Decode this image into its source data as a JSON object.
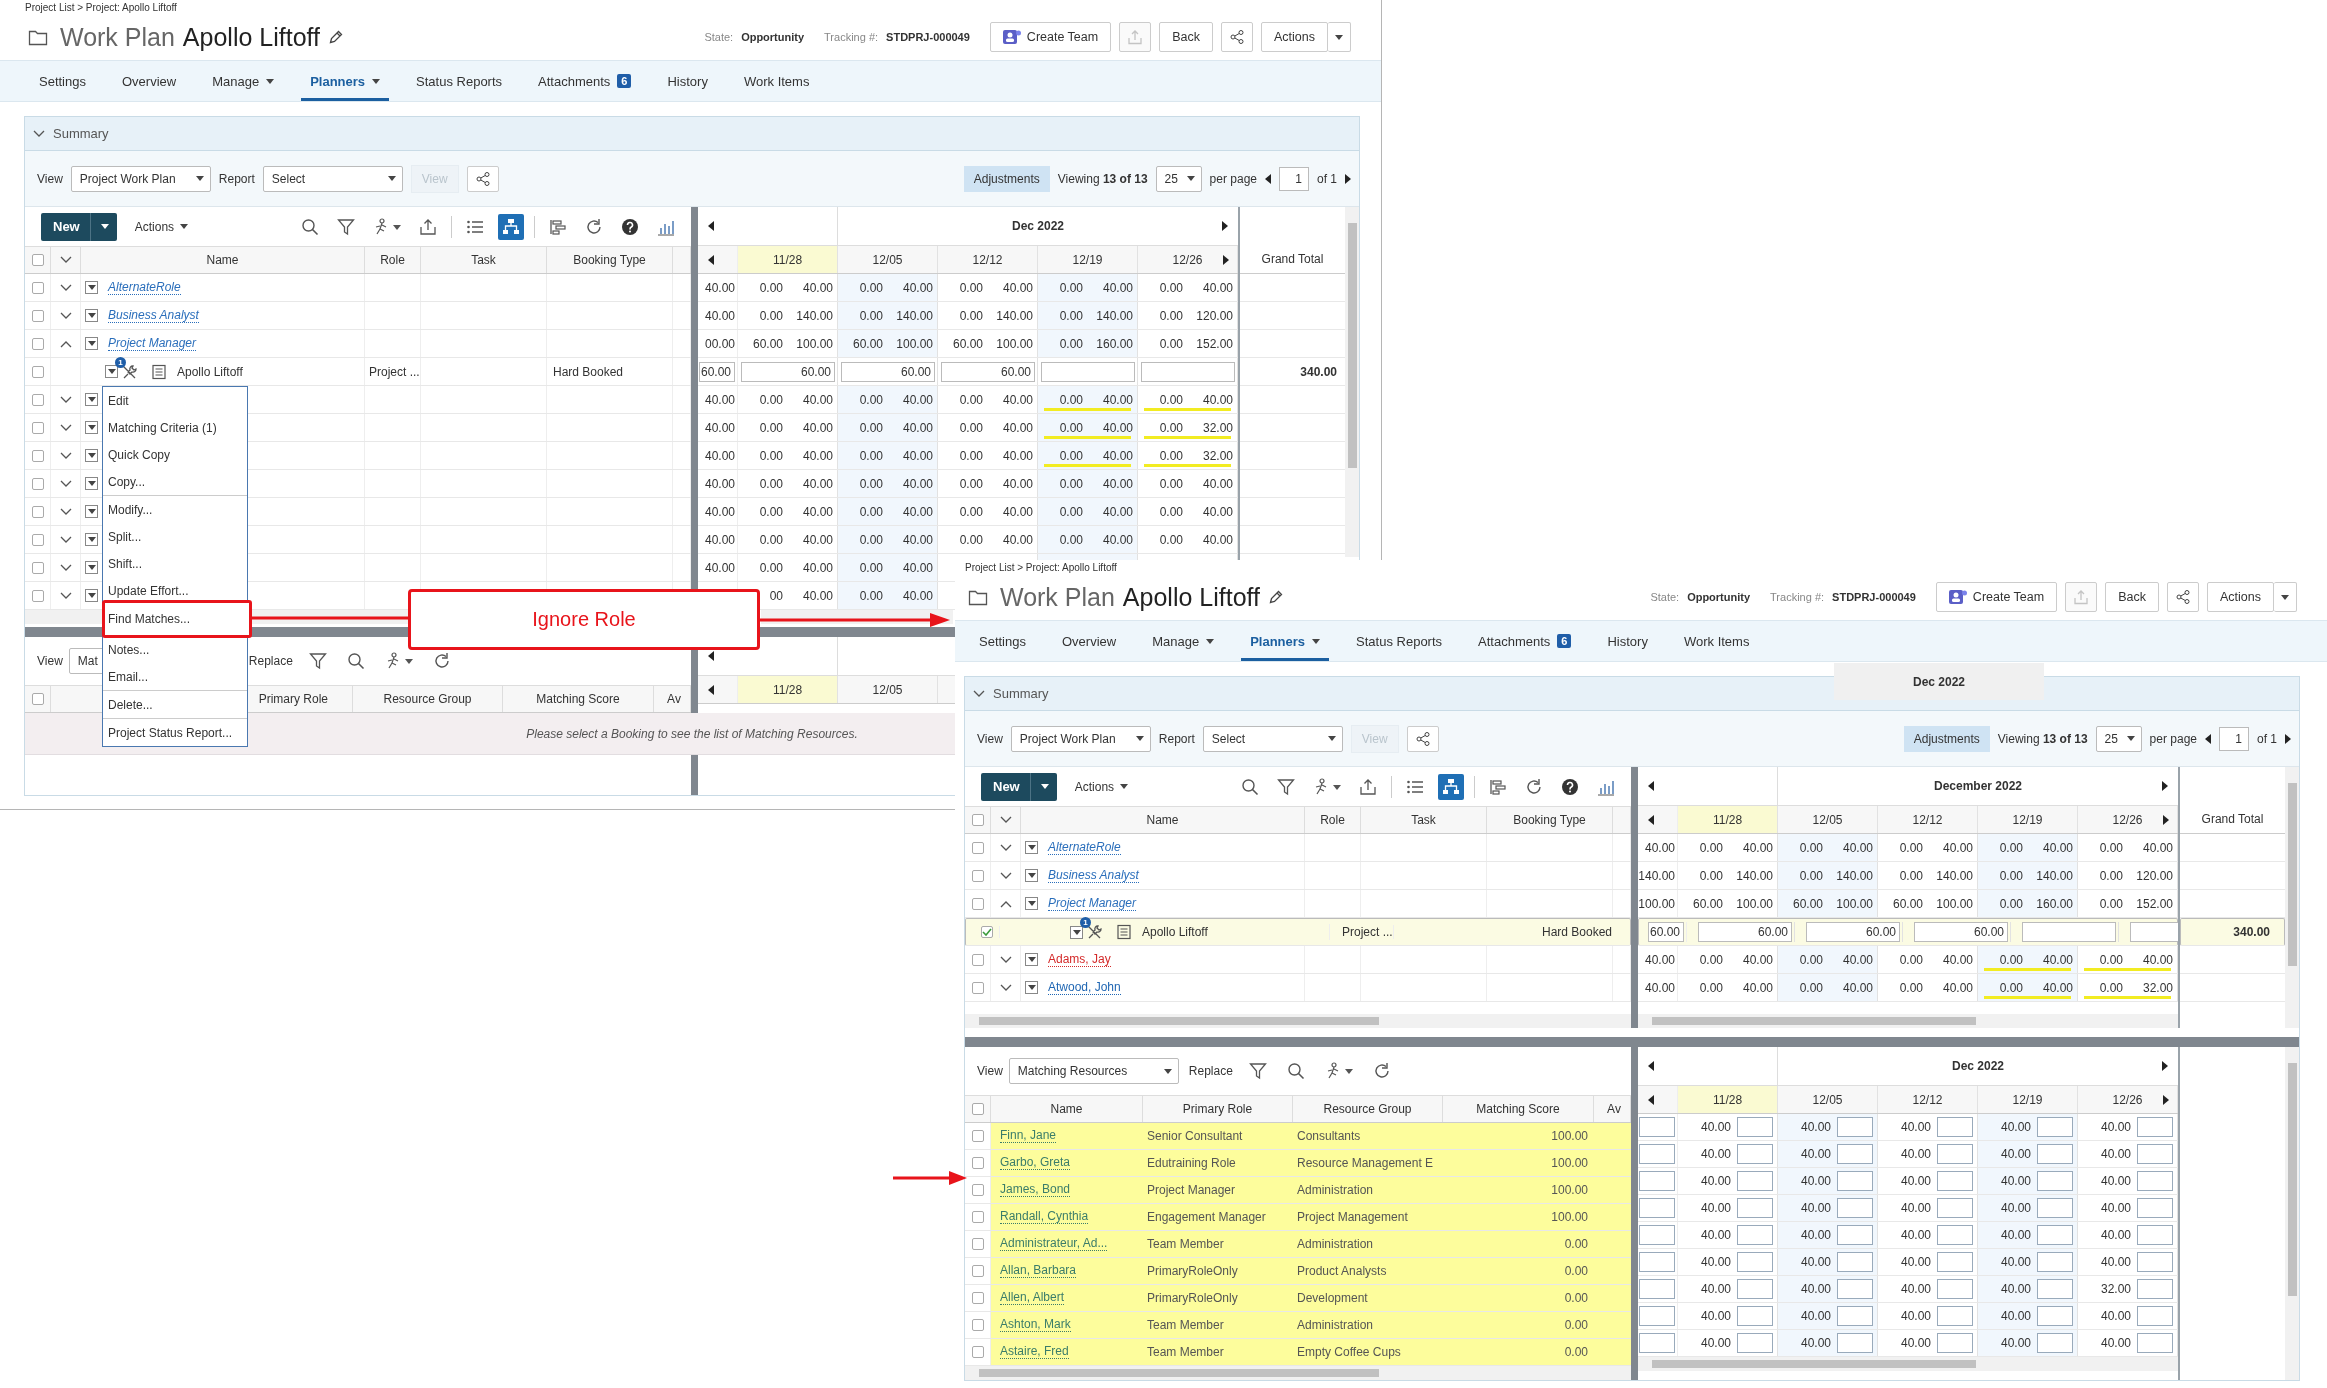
{
  "screens": [
    {
      "breadcrumb": "Project List > Project: Apollo Liftoff",
      "title_prefix": "Work Plan",
      "title": "Apollo Liftoff",
      "state_label": "State:",
      "state": "Opportunity",
      "tracking_label": "Tracking #:",
      "tracking": "STDPRJ-000049",
      "create_team": "Create Team",
      "export_disabled": true,
      "back": "Back",
      "actions": "Actions",
      "tabs": [
        {
          "label": "Settings",
          "selected": false,
          "dropdown": false
        },
        {
          "label": "Overview",
          "selected": false,
          "dropdown": false
        },
        {
          "label": "Manage",
          "selected": false,
          "dropdown": true
        },
        {
          "label": "Planners",
          "selected": true,
          "dropdown": true
        },
        {
          "label": "Status Reports",
          "selected": false,
          "dropdown": false
        },
        {
          "label": "Attachments",
          "selected": false,
          "dropdown": false,
          "badge": "6"
        },
        {
          "label": "History",
          "selected": false,
          "dropdown": false
        },
        {
          "label": "Work Items",
          "selected": false,
          "dropdown": false
        }
      ],
      "summary": "Summary",
      "toolbar": {
        "view_label": "View",
        "view": "Project Work Plan",
        "report_label": "Report",
        "report": "Select",
        "view_button": "View",
        "view_button_disabled": true,
        "adjustments": "Adjustments",
        "viewing": "Viewing **13 of 13**",
        "per_page": "25",
        "per_page_label": "per page",
        "page": "1",
        "page_count": "of 1"
      },
      "grid": {
        "new": "New",
        "actions": "Actions",
        "tools": [
          {
            "kind": "search",
            "selected": false
          },
          {
            "kind": "filter",
            "selected": false
          },
          {
            "kind": "assign",
            "selected": false
          },
          {
            "kind": "export",
            "selected": false
          },
          {
            "kind": "list",
            "selected": false
          },
          {
            "kind": "org",
            "selected": true
          },
          {
            "kind": "gantt",
            "selected": false
          },
          {
            "kind": "refresh",
            "selected": false
          },
          {
            "kind": "help",
            "selected": false
          },
          {
            "kind": "chart",
            "selected": false
          }
        ],
        "select_all": false,
        "columns": [
          "Name",
          "Role",
          "Task",
          "Booking Type"
        ],
        "month": "Dec 2022",
        "weeks": [
          "11/28",
          "12/05",
          "12/12",
          "12/19",
          "12/26"
        ],
        "grand_total": "Grand Total",
        "rows": [
          {
            "kind": "group",
            "name": "AlternateRole",
            "checked": false,
            "expanded": false,
            "lead": "40.00",
            "weeks": [
              [
                "0.00",
                "40.00"
              ],
              [
                "0.00",
                "40.00"
              ],
              [
                "0.00",
                "40.00"
              ],
              [
                "0.00",
                "40.00"
              ],
              [
                "0.00",
                "40.00"
              ]
            ],
            "underlined": [
              false,
              false,
              false,
              false,
              false
            ]
          },
          {
            "kind": "group",
            "name": "Business Analyst",
            "checked": false,
            "expanded": false,
            "lead": "40.00",
            "weeks": [
              [
                "0.00",
                "140.00"
              ],
              [
                "0.00",
                "140.00"
              ],
              [
                "0.00",
                "140.00"
              ],
              [
                "0.00",
                "140.00"
              ],
              [
                "0.00",
                "120.00"
              ]
            ],
            "underlined": [
              false,
              false,
              false,
              false,
              false
            ]
          },
          {
            "kind": "group",
            "name": "Project Manager",
            "checked": false,
            "expanded": true,
            "lead": "00.00",
            "weeks": [
              [
                "60.00",
                "100.00"
              ],
              [
                "60.00",
                "100.00"
              ],
              [
                "60.00",
                "100.00"
              ],
              [
                "0.00",
                "160.00"
              ],
              [
                "0.00",
                "152.00"
              ]
            ],
            "underlined": [
              false,
              false,
              false,
              false,
              false
            ]
          },
          {
            "kind": "booking",
            "name": "Apollo Liftoff",
            "badge": "1",
            "role": "Project ...",
            "booking_type": "Hard Booked",
            "checked": false,
            "lead": "60.00",
            "weeks": [
              "60.00",
              "60.00",
              "60.00"
            ],
            "grand_total": "340.00"
          },
          {
            "kind": "resource",
            "checked": false,
            "expanded": false,
            "lead": "40.00",
            "weeks": [
              [
                "0.00",
                "40.00"
              ],
              [
                "0.00",
                "40.00"
              ],
              [
                "0.00",
                "40.00"
              ],
              [
                "0.00",
                "40.00"
              ],
              [
                "0.00",
                "40.00"
              ]
            ],
            "underlined": [
              false,
              false,
              false,
              true,
              true
            ]
          },
          {
            "kind": "resource",
            "checked": false,
            "expanded": false,
            "lead": "40.00",
            "weeks": [
              [
                "0.00",
                "40.00"
              ],
              [
                "0.00",
                "40.00"
              ],
              [
                "0.00",
                "40.00"
              ],
              [
                "0.00",
                "40.00"
              ],
              [
                "0.00",
                "32.00"
              ]
            ],
            "underlined": [
              false,
              false,
              false,
              true,
              true
            ]
          },
          {
            "kind": "resource",
            "checked": false,
            "expanded": false,
            "lead": "40.00",
            "weeks": [
              [
                "0.00",
                "40.00"
              ],
              [
                "0.00",
                "40.00"
              ],
              [
                "0.00",
                "40.00"
              ],
              [
                "0.00",
                "40.00"
              ],
              [
                "0.00",
                "32.00"
              ]
            ],
            "underlined": [
              false,
              false,
              false,
              true,
              true
            ]
          },
          {
            "kind": "resource",
            "checked": false,
            "expanded": false,
            "lead": "40.00",
            "weeks": [
              [
                "0.00",
                "40.00"
              ],
              [
                "0.00",
                "40.00"
              ],
              [
                "0.00",
                "40.00"
              ],
              [
                "0.00",
                "40.00"
              ],
              [
                "0.00",
                "40.00"
              ]
            ],
            "underlined": [
              false,
              false,
              false,
              false,
              false
            ]
          },
          {
            "kind": "resource",
            "checked": false,
            "expanded": false,
            "lead": "40.00",
            "weeks": [
              [
                "0.00",
                "40.00"
              ],
              [
                "0.00",
                "40.00"
              ],
              [
                "0.00",
                "40.00"
              ],
              [
                "0.00",
                "40.00"
              ],
              [
                "0.00",
                "40.00"
              ]
            ],
            "underlined": [
              false,
              false,
              false,
              false,
              false
            ]
          },
          {
            "kind": "resource",
            "checked": false,
            "expanded": false,
            "lead": "40.00",
            "weeks": [
              [
                "0.00",
                "40.00"
              ],
              [
                "0.00",
                "40.00"
              ],
              [
                "0.00",
                "40.00"
              ],
              [
                "0.00",
                "40.00"
              ],
              [
                "0.00",
                "40.00"
              ]
            ],
            "underlined": [
              false,
              false,
              false,
              false,
              false
            ]
          },
          {
            "kind": "resource",
            "checked": false,
            "expanded": false,
            "lead": "40.00",
            "weeks": [
              [
                "0.00",
                "40.00"
              ],
              [
                "0.00",
                "40.00"
              ]
            ],
            "underlined": [
              false,
              false
            ]
          },
          {
            "kind": "resource",
            "checked": false,
            "expanded": false,
            "weeks": [
              [
                "00",
                "40.00"
              ],
              [
                "0.00",
                "40.00"
              ]
            ],
            "underlined": [
              false,
              false
            ]
          }
        ]
      },
      "lower": {
        "view_label": "View",
        "view": "Mat",
        "replace": "Replace",
        "tools": [
          {
            "kind": "filter",
            "selected": false
          },
          {
            "kind": "search",
            "selected": false
          },
          {
            "kind": "assign",
            "selected": false
          },
          {
            "kind": "refresh",
            "selected": false
          }
        ],
        "select_all": false,
        "columns": [
          {
            "kind": "primary_role",
            "label": "Primary Role"
          },
          {
            "kind": "group",
            "label": "Resource Group"
          },
          {
            "kind": "score",
            "label": "Matching Score"
          },
          {
            "kind": "available",
            "label": "Av"
          }
        ],
        "weeks": [
          "11/28",
          "12/05"
        ],
        "message": "Please select a Booking to see the list of Matching Resources."
      }
    },
    {
      "breadcrumb": "Project List > Project: Apollo Liftoff",
      "title_prefix": "Work Plan",
      "title": "Apollo Liftoff",
      "state_label": "State:",
      "state": "Opportunity",
      "tracking_label": "Tracking #:",
      "tracking": "STDPRJ-000049",
      "create_team": "Create Team",
      "export_disabled": true,
      "back": "Back",
      "actions": "Actions",
      "tabs": [
        {
          "label": "Settings",
          "selected": false,
          "dropdown": false
        },
        {
          "label": "Overview",
          "selected": false,
          "dropdown": false
        },
        {
          "label": "Manage",
          "selected": false,
          "dropdown": true
        },
        {
          "label": "Planners",
          "selected": true,
          "dropdown": true
        },
        {
          "label": "Status Reports",
          "selected": false,
          "dropdown": false
        },
        {
          "label": "Attachments",
          "selected": false,
          "dropdown": false,
          "badge": "6"
        },
        {
          "label": "History",
          "selected": false,
          "dropdown": false
        },
        {
          "label": "Work Items",
          "selected": false,
          "dropdown": false
        }
      ],
      "floating_label": "Dec 2022",
      "summary": "Summary",
      "toolbar": {
        "view_label": "View",
        "view": "Project Work Plan",
        "report_label": "Report",
        "report": "Select",
        "view_button": "View",
        "view_button_disabled": true,
        "adjustments": "Adjustments",
        "viewing": "Viewing **13 of 13**",
        "per_page": "25",
        "per_page_label": "per page",
        "page": "1",
        "page_count": "of 1"
      },
      "grid": {
        "new": "New",
        "actions": "Actions",
        "tools": [
          {
            "kind": "search",
            "selected": false
          },
          {
            "kind": "filter",
            "selected": false
          },
          {
            "kind": "assign",
            "selected": false
          },
          {
            "kind": "export",
            "selected": false
          },
          {
            "kind": "list",
            "selected": false
          },
          {
            "kind": "org",
            "selected": true
          },
          {
            "kind": "gantt",
            "selected": false
          },
          {
            "kind": "refresh",
            "selected": false
          },
          {
            "kind": "help",
            "selected": false
          },
          {
            "kind": "chart",
            "selected": false
          }
        ],
        "select_all": false,
        "columns": [
          "Name",
          "Role",
          "Task",
          "Booking Type"
        ],
        "month": "December 2022",
        "weeks": [
          "11/28",
          "12/05",
          "12/12",
          "12/19",
          "12/26"
        ],
        "grand_total": "Grand Total",
        "rows": [
          {
            "kind": "group",
            "name": "AlternateRole",
            "checked": false,
            "expanded": false,
            "lead": "40.00",
            "weeks": [
              [
                "0.00",
                "40.00"
              ],
              [
                "0.00",
                "40.00"
              ],
              [
                "0.00",
                "40.00"
              ],
              [
                "0.00",
                "40.00"
              ],
              [
                "0.00",
                "40.00"
              ]
            ],
            "underlined": [
              false,
              false,
              false,
              false,
              false
            ]
          },
          {
            "kind": "group",
            "name": "Business Analyst",
            "checked": false,
            "expanded": false,
            "lead": "140.00",
            "weeks": [
              [
                "0.00",
                "140.00"
              ],
              [
                "0.00",
                "140.00"
              ],
              [
                "0.00",
                "140.00"
              ],
              [
                "0.00",
                "140.00"
              ],
              [
                "0.00",
                "120.00"
              ]
            ],
            "underlined": [
              false,
              false,
              false,
              false,
              false
            ]
          },
          {
            "kind": "group",
            "name": "Project Manager",
            "checked": false,
            "expanded": true,
            "lead": "100.00",
            "weeks": [
              [
                "60.00",
                "100.00"
              ],
              [
                "60.00",
                "100.00"
              ],
              [
                "60.00",
                "100.00"
              ],
              [
                "0.00",
                "160.00"
              ],
              [
                "0.00",
                "152.00"
              ]
            ],
            "underlined": [
              false,
              false,
              false,
              false,
              false
            ]
          },
          {
            "kind": "booking",
            "name": "Apollo Liftoff",
            "badge": "1",
            "role": "Project ...",
            "booking_type": "Hard Booked",
            "checked": true,
            "lead": "60.00",
            "weeks": [
              "60.00",
              "60.00",
              "60.00"
            ],
            "grand_total": "340.00"
          },
          {
            "kind": "resource",
            "name": "Adams, Jay",
            "color": "#d42a2a",
            "checked": false,
            "expanded": false,
            "lead": "40.00",
            "weeks": [
              [
                "0.00",
                "40.00"
              ],
              [
                "0.00",
                "40.00"
              ],
              [
                "0.00",
                "40.00"
              ],
              [
                "0.00",
                "40.00"
              ],
              [
                "0.00",
                "40.00"
              ]
            ],
            "underlined": [
              false,
              false,
              false,
              true,
              true
            ]
          },
          {
            "kind": "resource",
            "name": "Atwood, John",
            "color": "#1f66b3",
            "checked": false,
            "expanded": false,
            "lead": "40.00",
            "weeks": [
              [
                "0.00",
                "40.00"
              ],
              [
                "0.00",
                "40.00"
              ],
              [
                "0.00",
                "40.00"
              ],
              [
                "0.00",
                "40.00"
              ],
              [
                "0.00",
                "32.00"
              ]
            ],
            "underlined": [
              false,
              false,
              false,
              true,
              true
            ]
          }
        ]
      },
      "lower": {
        "view_label": "View",
        "view": "Matching Resources",
        "replace": "Replace",
        "tools": [
          {
            "kind": "filter",
            "selected": false
          },
          {
            "kind": "search",
            "selected": false
          },
          {
            "kind": "assign",
            "selected": false
          },
          {
            "kind": "refresh",
            "selected": false
          }
        ],
        "select_all": false,
        "columns": [
          {
            "kind": "name",
            "label": "Name"
          },
          {
            "kind": "primary_role",
            "label": "Primary Role"
          },
          {
            "kind": "group",
            "label": "Resource Group"
          },
          {
            "kind": "score",
            "label": "Matching Score"
          },
          {
            "kind": "available",
            "label": "Av"
          }
        ],
        "month": "Dec 2022",
        "weeks": [
          "11/28",
          "12/05",
          "12/12",
          "12/19",
          "12/26"
        ],
        "rows": [
          {
            "name": "Finn, Jane",
            "primary_role": "Senior Consultant",
            "group": "Consultants",
            "score": "100.00",
            "highlighted": true,
            "checked": false,
            "weeks": [
              "40.00",
              "40.00",
              "40.00",
              "40.00",
              "40.00"
            ]
          },
          {
            "name": "Garbo, Greta",
            "primary_role": "Edutraining Role",
            "group": "Resource Management E",
            "score": "100.00",
            "highlighted": true,
            "checked": false,
            "weeks": [
              "40.00",
              "40.00",
              "40.00",
              "40.00",
              "40.00"
            ]
          },
          {
            "name": "James, Bond",
            "primary_role": "Project Manager",
            "group": "Administration",
            "score": "100.00",
            "highlighted": true,
            "checked": false,
            "weeks": [
              "40.00",
              "40.00",
              "40.00",
              "40.00",
              "40.00"
            ]
          },
          {
            "name": "Randall, Cynthia",
            "primary_role": "Engagement Manager",
            "group": "Project Management",
            "score": "100.00",
            "highlighted": true,
            "checked": false,
            "weeks": [
              "40.00",
              "40.00",
              "40.00",
              "40.00",
              "40.00"
            ]
          },
          {
            "name": "Administrateur, Ad...",
            "primary_role": "Team Member",
            "group": "Administration",
            "score": "0.00",
            "highlighted": true,
            "checked": false,
            "weeks": [
              "40.00",
              "40.00",
              "40.00",
              "40.00",
              "40.00"
            ]
          },
          {
            "name": "Allan, Barbara",
            "primary_role": "PrimaryRoleOnly",
            "group": "Product Analysts",
            "score": "0.00",
            "highlighted": true,
            "checked": false,
            "weeks": [
              "40.00",
              "40.00",
              "40.00",
              "40.00",
              "40.00"
            ]
          },
          {
            "name": "Allen, Albert",
            "primary_role": "PrimaryRoleOnly",
            "group": "Development",
            "score": "0.00",
            "highlighted": true,
            "checked": false,
            "weeks": [
              "40.00",
              "40.00",
              "40.00",
              "40.00",
              "32.00"
            ]
          },
          {
            "name": "Ashton, Mark",
            "primary_role": "Team Member",
            "group": "Administration",
            "score": "0.00",
            "highlighted": true,
            "checked": false,
            "weeks": [
              "40.00",
              "40.00",
              "40.00",
              "40.00",
              "40.00"
            ]
          },
          {
            "name": "Astaire, Fred",
            "primary_role": "Team Member",
            "group": "Empty Coffee Cups",
            "score": "0.00",
            "highlighted": true,
            "checked": false,
            "weeks": [
              "40.00",
              "40.00",
              "40.00",
              "40.00",
              "40.00"
            ]
          }
        ]
      }
    }
  ],
  "menu": [
    {
      "items": [
        {
          "label": "Edit",
          "highlighted": false
        },
        {
          "label": "Matching Criteria (1)",
          "highlighted": false
        },
        {
          "label": "Quick Copy",
          "highlighted": false
        },
        {
          "label": "Copy...",
          "highlighted": false
        }
      ]
    },
    {
      "items": [
        {
          "label": "Modify...",
          "highlighted": false
        },
        {
          "label": "Split...",
          "highlighted": false
        },
        {
          "label": "Shift...",
          "highlighted": false
        },
        {
          "label": "Update Effort...",
          "highlighted": false
        }
      ]
    },
    {
      "items": [
        {
          "label": "Find Matches...",
          "highlighted": true
        }
      ]
    },
    {
      "items": [
        {
          "label": "Notes...",
          "highlighted": false
        },
        {
          "label": "Email...",
          "highlighted": false
        }
      ]
    },
    {
      "items": [
        {
          "label": "Delete...",
          "highlighted": false
        }
      ]
    },
    {
      "items": [
        {
          "label": "Project Status Report...",
          "highlighted": false
        }
      ]
    }
  ],
  "callout": "Ignore Role"
}
